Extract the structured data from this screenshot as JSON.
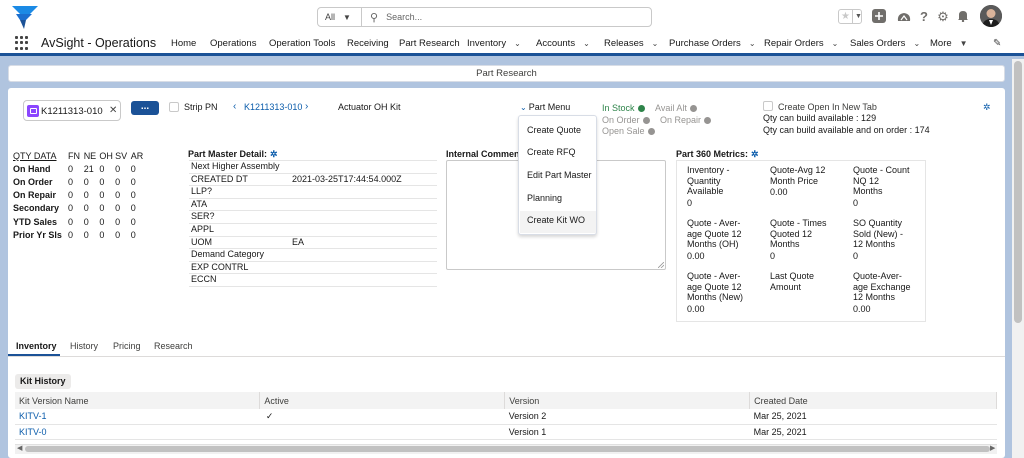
{
  "header": {
    "search_scope": "All",
    "search_placeholder": "Search...",
    "icons": [
      "favorites-star-icon",
      "add-icon",
      "trailhead-icon",
      "help-icon",
      "settings-icon",
      "notifications-bell-icon",
      "user-avatar"
    ]
  },
  "app_nav": {
    "app_name": "AvSight - Operations",
    "items": [
      {
        "label": "Home",
        "dropdown": false
      },
      {
        "label": "Operations",
        "dropdown": false
      },
      {
        "label": "Operation Tools",
        "dropdown": false
      },
      {
        "label": "Receiving",
        "dropdown": false
      },
      {
        "label": "Part Research",
        "dropdown": false
      },
      {
        "label": "Inventory",
        "dropdown": true
      },
      {
        "label": "Accounts",
        "dropdown": true
      },
      {
        "label": "Releases",
        "dropdown": true
      },
      {
        "label": "Purchase Orders",
        "dropdown": true
      },
      {
        "label": "Repair Orders",
        "dropdown": true
      },
      {
        "label": "Sales Orders",
        "dropdown": true
      },
      {
        "label": "More",
        "dropdown": true
      }
    ]
  },
  "page_title": "Part Research",
  "toolbar": {
    "pn_value": "K1211313-010",
    "dots_label": "...",
    "strip_pn_label": "Strip PN",
    "pn_link": "K1211313-010",
    "pn_description": "Actuator OH Kit",
    "part_menu_label": "Part Menu",
    "open_new_tab_label": "Create Open In New Tab",
    "qty_build": "Qty can build available : 129",
    "qty_build_order": "Qty can build available and on order : 174"
  },
  "part_menu": [
    "Create Quote",
    "Create RFQ",
    "Edit Part Master",
    "Planning",
    "Create Kit WO"
  ],
  "status": {
    "in_stock": "In Stock",
    "avail_alt": "Avail Alt",
    "on_order": "On Order",
    "on_repair": "On Repair",
    "open_sale": "Open Sale",
    "in_stock_color": "#2e844a",
    "inactive_color": "#969492"
  },
  "qty_data": {
    "headers": [
      "QTY DATA",
      "FN",
      "NE",
      "OH",
      "SV",
      "AR"
    ],
    "rows": [
      {
        "label": "On Hand",
        "values": [
          "0",
          "21",
          "0",
          "0",
          "0"
        ]
      },
      {
        "label": "On Order",
        "values": [
          "0",
          "0",
          "0",
          "0",
          "0"
        ]
      },
      {
        "label": "On Repair",
        "values": [
          "0",
          "0",
          "0",
          "0",
          "0"
        ]
      },
      {
        "label": "Secondary",
        "values": [
          "0",
          "0",
          "0",
          "0",
          "0"
        ]
      },
      {
        "label": "YTD Sales",
        "values": [
          "0",
          "0",
          "0",
          "0",
          "0"
        ]
      },
      {
        "label": "Prior Yr Sls",
        "values": [
          "0",
          "0",
          "0",
          "0",
          "0"
        ]
      }
    ]
  },
  "part_master": {
    "title": "Part Master Detail:",
    "rows": [
      {
        "key": "Next Higher Assembly",
        "value": ""
      },
      {
        "key": "CREATED DT",
        "value": "2021-03-25T17:44:54.000Z"
      },
      {
        "key": "LLP?",
        "value": ""
      },
      {
        "key": "ATA",
        "value": ""
      },
      {
        "key": "SER?",
        "value": ""
      },
      {
        "key": "APPL",
        "value": ""
      },
      {
        "key": "UOM",
        "value": "EA"
      },
      {
        "key": "Demand Category",
        "value": ""
      },
      {
        "key": "EXP CONTRL",
        "value": ""
      },
      {
        "key": "ECCN",
        "value": ""
      }
    ]
  },
  "internal_comments": {
    "title": "Internal Comments"
  },
  "metrics": {
    "title": "Part 360 Metrics:",
    "items": [
      {
        "label": "Inventory - Quantity Available",
        "value": "0"
      },
      {
        "label": "Quote-Avg 12 Month Price",
        "value": "0.00"
      },
      {
        "label": "Quote - Count NQ 12 Months",
        "value": "0"
      },
      {
        "label": "Quote - Average Quote 12 Months (OH)",
        "value": "0.00"
      },
      {
        "label": "Quote - Times Quoted 12 Months",
        "value": "0"
      },
      {
        "label": "SO Quantity Sold (New) - 12 Months",
        "value": "0"
      },
      {
        "label": "Quote - Average Quote 12 Months (New)",
        "value": "0.00"
      },
      {
        "label": "Last Quote Amount",
        "value": ""
      },
      {
        "label": "Quote-Average Exchange 12 Months",
        "value": "0.00"
      }
    ]
  },
  "tabs": [
    "Inventory",
    "History",
    "Pricing",
    "Research"
  ],
  "active_tab": "Inventory",
  "kit_history": {
    "badge": "Kit History",
    "columns": [
      "Kit Version Name",
      "Active",
      "Version",
      "Created Date"
    ],
    "rows": [
      {
        "name": "KITV-1",
        "active": "✓",
        "version": "Version 2",
        "created": "Mar 25, 2021"
      },
      {
        "name": "KITV-0",
        "active": "",
        "version": "Version 1",
        "created": "Mar 25, 2021"
      }
    ]
  }
}
